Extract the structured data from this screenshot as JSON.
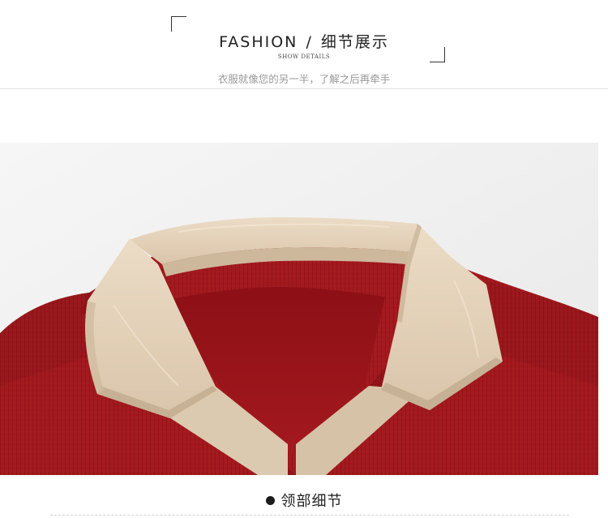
{
  "header": {
    "title_en": "FASHION",
    "title_sep": "/",
    "title_cn": "细节展示",
    "subtitle_en": "SHOW DETAILS",
    "tagline": "衣服就像您的另一半，了解之后再牵手"
  },
  "photo": {
    "subject": "sweater-collar-photo",
    "colors": {
      "knit_red": "#a3191e",
      "knit_red_dark": "#7d0f14",
      "collar_beige": "#e3d2bb",
      "collar_shadow": "#c9b59b",
      "background": "#f1f1f1"
    }
  },
  "caption": {
    "label": "领部细节"
  }
}
